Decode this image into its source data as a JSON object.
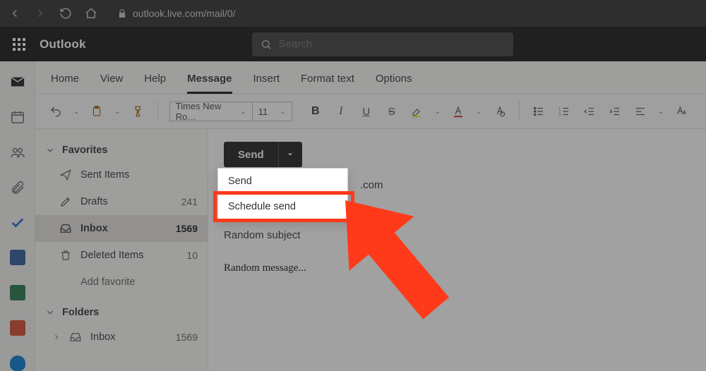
{
  "browser": {
    "url": "outlook.live.com/mail/0/"
  },
  "suite": {
    "brand": "Outlook",
    "search_placeholder": "Search"
  },
  "tabs": [
    "Home",
    "View",
    "Help",
    "Message",
    "Insert",
    "Format text",
    "Options"
  ],
  "active_tab": "Message",
  "ribbon": {
    "font_name": "Times New Ro…",
    "font_size": "11"
  },
  "folders": {
    "favorites_label": "Favorites",
    "folders_label": "Folders",
    "add_favorite_label": "Add favorite",
    "items": [
      {
        "icon": "sent",
        "label": "Sent Items",
        "count": ""
      },
      {
        "icon": "drafts",
        "label": "Drafts",
        "count": "241"
      },
      {
        "icon": "inbox",
        "label": "Inbox",
        "count": "1569",
        "selected": true
      },
      {
        "icon": "trash",
        "label": "Deleted Items",
        "count": "10"
      }
    ],
    "sub": [
      {
        "icon": "inbox",
        "label": "Inbox",
        "count": "1569"
      }
    ]
  },
  "compose": {
    "send_label": "Send",
    "menu": [
      "Send",
      "Schedule send"
    ],
    "to_fragment": ".com",
    "subject": "Random subject",
    "body": "Random message..."
  },
  "colors": {
    "highlight": "#ff3a1a"
  }
}
